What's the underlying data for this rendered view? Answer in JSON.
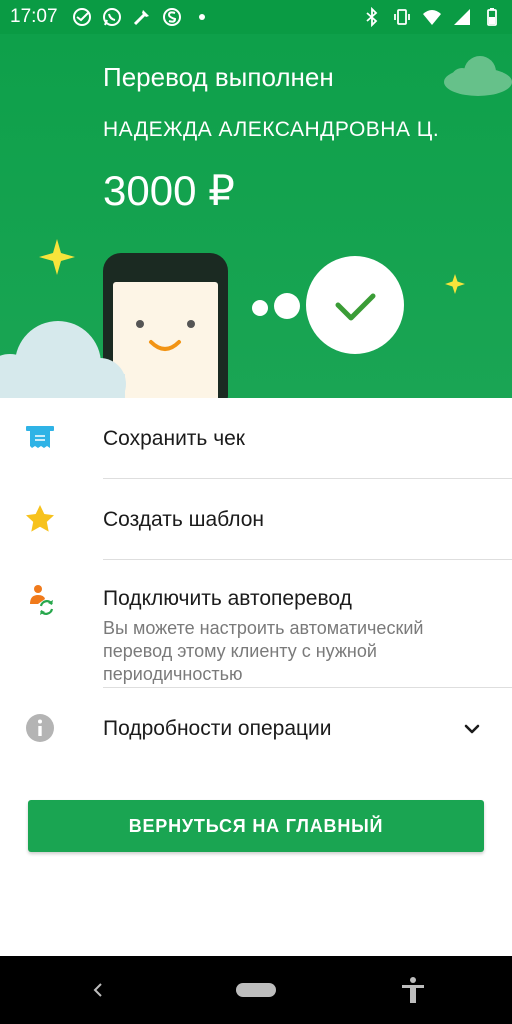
{
  "status_bar": {
    "time": "17:07",
    "icons": [
      "sber-icon",
      "whatsapp-icon",
      "tools-icon",
      "s-app-icon",
      "dot-icon",
      "bluetooth-icon",
      "vibrate-icon",
      "wifi-icon",
      "signal-icon",
      "battery-icon"
    ]
  },
  "hero": {
    "title": "Перевод выполнен",
    "recipient": "НАДЕЖДА АЛЕКСАНДРОВНА Ц.",
    "amount": "3000 ₽",
    "colors": {
      "background": "#0ea04a",
      "cloud": "#d9eaee",
      "sparkle": "#f7e43b",
      "check": "#3a9c36"
    }
  },
  "menu": {
    "save_receipt": "Сохранить чек",
    "create_template": "Создать шаблон",
    "autotransfer": {
      "label": "Подключить автоперевод",
      "description": "Вы можете настроить автоматический перевод этому клиенту с нужной периодичностью"
    },
    "details": "Подробности операции"
  },
  "primary_button": {
    "label": "ВЕРНУТЬСЯ НА ГЛАВНЫЙ",
    "color": "#1aa552"
  },
  "nav_bar": {
    "icons": [
      "back-icon",
      "home-pill-icon",
      "accessibility-icon"
    ]
  }
}
